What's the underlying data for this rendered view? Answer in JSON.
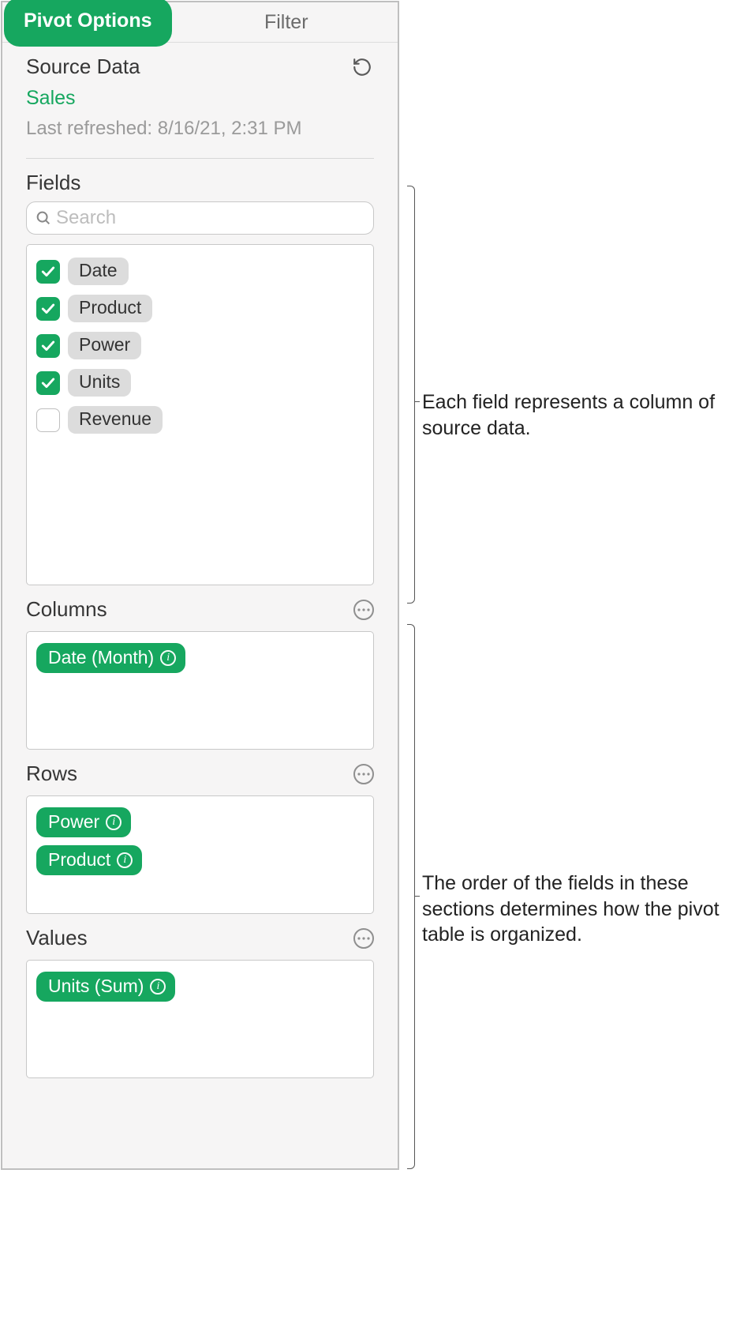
{
  "tabs": {
    "pivot": "Pivot Options",
    "filter": "Filter"
  },
  "source": {
    "title": "Source Data",
    "name": "Sales",
    "timestamp": "Last refreshed: 8/16/21, 2:31 PM"
  },
  "fields": {
    "title": "Fields",
    "search_placeholder": "Search",
    "items": [
      {
        "label": "Date",
        "checked": true
      },
      {
        "label": "Product",
        "checked": true
      },
      {
        "label": "Power",
        "checked": true
      },
      {
        "label": "Units",
        "checked": true
      },
      {
        "label": "Revenue",
        "checked": false
      }
    ]
  },
  "columns": {
    "title": "Columns",
    "items": [
      "Date (Month)"
    ]
  },
  "rows": {
    "title": "Rows",
    "items": [
      "Power",
      "Product"
    ]
  },
  "values": {
    "title": "Values",
    "items": [
      "Units (Sum)"
    ]
  },
  "callouts": {
    "fields": "Each field represents a column of source data.",
    "order": "The order of the fields in these sections determines how the pivot table is organized."
  },
  "colors": {
    "accent": "#16a75f"
  }
}
